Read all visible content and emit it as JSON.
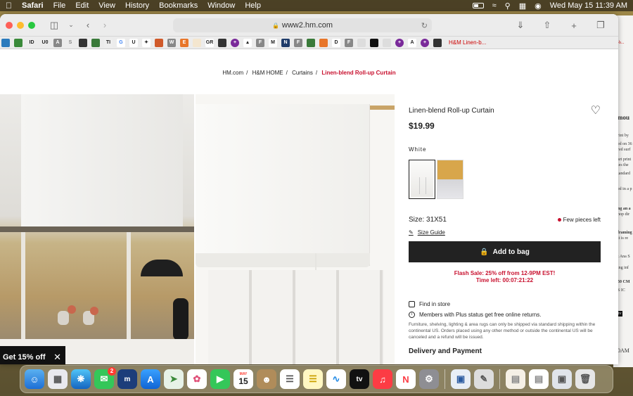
{
  "menubar": {
    "app": "Safari",
    "items": [
      "File",
      "Edit",
      "View",
      "History",
      "Bookmarks",
      "Window",
      "Help"
    ],
    "clock": "Wed May 15  11:39 AM"
  },
  "browser": {
    "url": "www2.hm.com",
    "favorites_last": "H&M Linen-b..."
  },
  "breadcrumb": {
    "items": [
      "HM.com",
      "H&M HOME",
      "Curtains"
    ],
    "current": "Linen-blend Roll-up Curtain"
  },
  "promo": {
    "label": "Get 15% off"
  },
  "product": {
    "title": "Linen-blend Roll-up Curtain",
    "price": "$19.99",
    "color": "White",
    "size": "Size: 31X51",
    "stock": "Few pieces left",
    "size_guide": "Size Guide",
    "add_to_bag": "Add to bag",
    "flash_line1": "Flash Sale: 25% off from 12-9PM EST!",
    "flash_line2": "Time left: 00:07:21:22",
    "find_in_store": "Find in store",
    "members": "Members with Plus status get free online returns.",
    "ship_note": "Furniture, shelving, lighting & area rugs can only be shipped via standard shipping within the continental US. Orders placed using any other method or outside the continental US will be canceled and a refund will be issued.",
    "delivery": "Delivery and Payment"
  },
  "dock": {
    "calendar_month": "MAY",
    "calendar_day": "15",
    "messages_badge": "2",
    "tv_label": "tv"
  },
  "background_window": {
    "lines": [
      "-b...",
      "mou",
      "rint by",
      "ed on 36",
      "red surf",
      "art print",
      "tes the",
      "tandard",
      "ed in a p",
      "ng an a",
      "hop dir",
      "framing",
      "it is re",
      "t Ana S",
      "ing inf",
      "50 CM",
      "S IC",
      "tv",
      "0AM",
      "AM"
    ]
  },
  "colors": {
    "accent_red": "#c8102e",
    "button_dark": "#222222"
  }
}
